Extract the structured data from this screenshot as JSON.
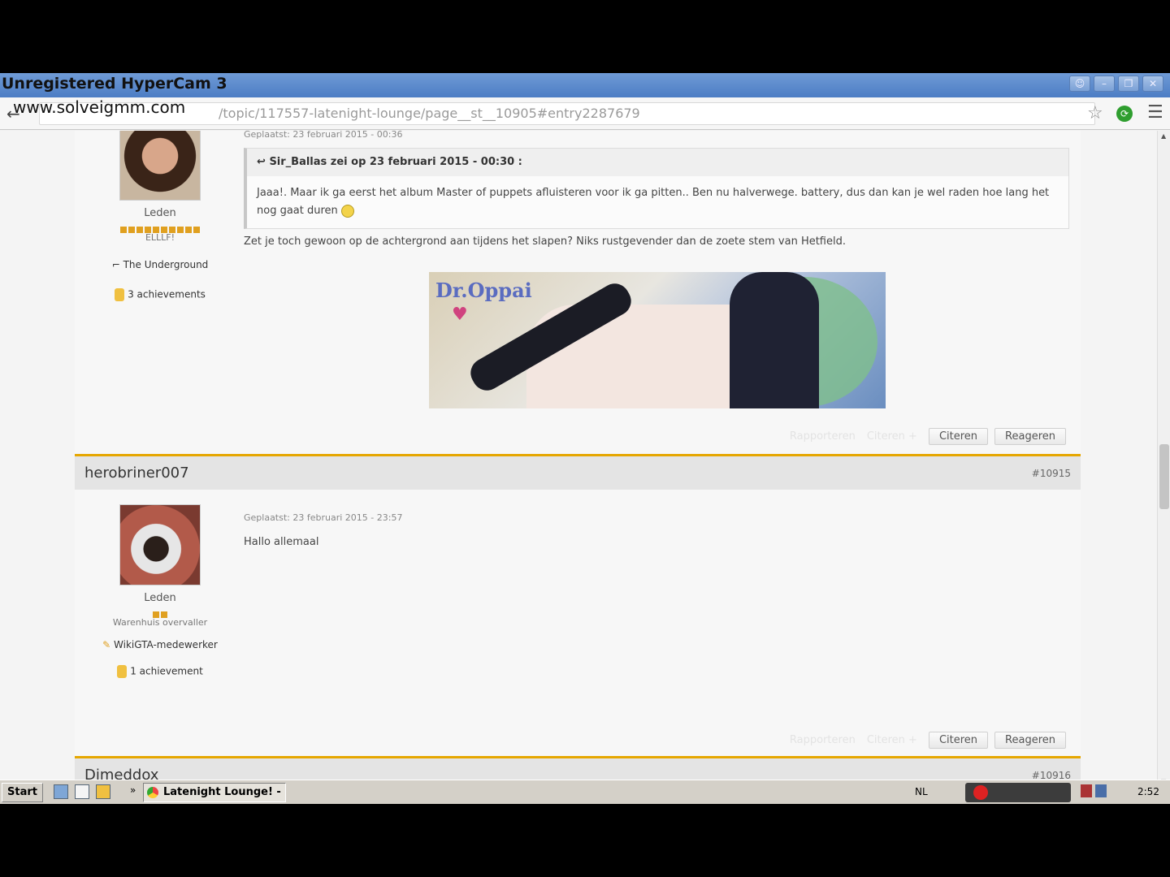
{
  "window": {
    "watermark": "Unregistered HyperCam 3",
    "watermark_url": "www.solveigmm.com"
  },
  "address": {
    "url": "/topic/117557-latenight-lounge/page__st__10905#entry2287679"
  },
  "posts": [
    {
      "rank": "Leden",
      "title": "ELLLF!",
      "group": "The Underground",
      "achievements": "3 achievements",
      "posted": "Geplaatst: 23 februari 2015 - 00:36",
      "quote_header": "Sir_Ballas zei op 23 februari 2015 - 00:30 :",
      "quote_text": "Jaaa!. Maar ik ga eerst het album Master of puppets afluisteren voor ik ga pitten.. Ben nu halverwege. battery, dus dan kan je wel raden hoe lang het nog gaat duren",
      "body": "Zet je toch gewoon op de achtergrond aan tijdens het slapen? Niks rustgevender dan de zoete stem van Hetfield.",
      "banner_text": "Dr.Oppai",
      "actions": {
        "report": "Rapporteren",
        "multi": "Citeren +",
        "quote": "Citeren",
        "reply": "Reageren"
      }
    },
    {
      "author": "herobriner007",
      "number": "#10915",
      "rank": "Leden",
      "title": "Warenhuis overvaller",
      "group": "WikiGTA-medewerker",
      "achievements": "1 achievement",
      "posted": "Geplaatst: 23 februari 2015 - 23:57",
      "body": "Hallo allemaal",
      "actions": {
        "report": "Rapporteren",
        "multi": "Citeren +",
        "quote": "Citeren",
        "reply": "Reageren"
      }
    },
    {
      "author": "Dimeddox",
      "number": "#10916"
    }
  ],
  "taskbar": {
    "start": "Start",
    "task": "Latenight Lounge! - ...",
    "lang": "NL",
    "clock": "2:52"
  }
}
